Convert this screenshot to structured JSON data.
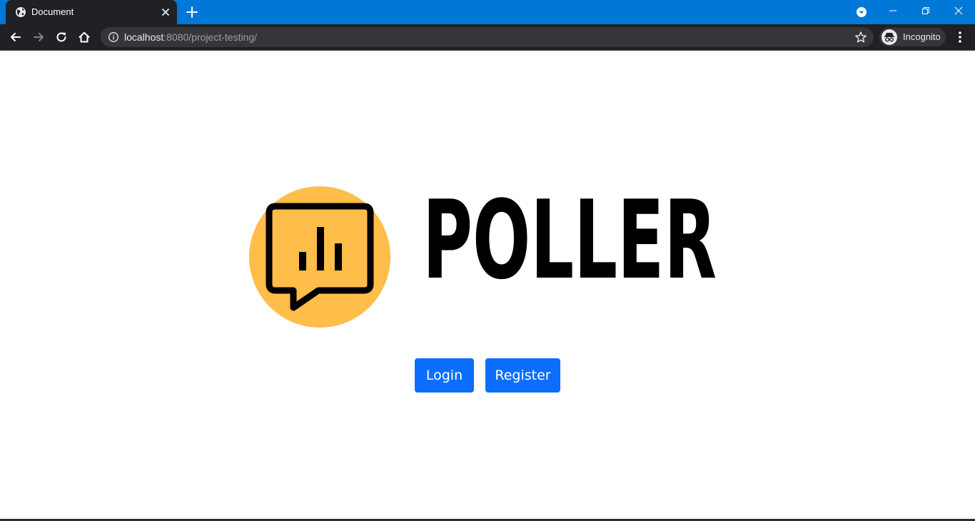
{
  "browser": {
    "tab": {
      "title": "Document",
      "favicon": "globe-icon"
    },
    "address_bar": {
      "host": "localhost",
      "path": ":8080/project-testing/"
    },
    "profile": {
      "label": "Incognito",
      "icon": "incognito-icon"
    },
    "colors": {
      "titlebar": "#0078d7",
      "toolbar": "#202124",
      "omnibox": "#35363a"
    }
  },
  "page": {
    "logo": {
      "wordmark": "POLLER",
      "mark_icon": "poll-chat-bubble-icon",
      "mark_color": "#ffbd4a"
    },
    "buttons": {
      "login_label": "Login",
      "register_label": "Register",
      "color": "#0d6efd"
    }
  }
}
